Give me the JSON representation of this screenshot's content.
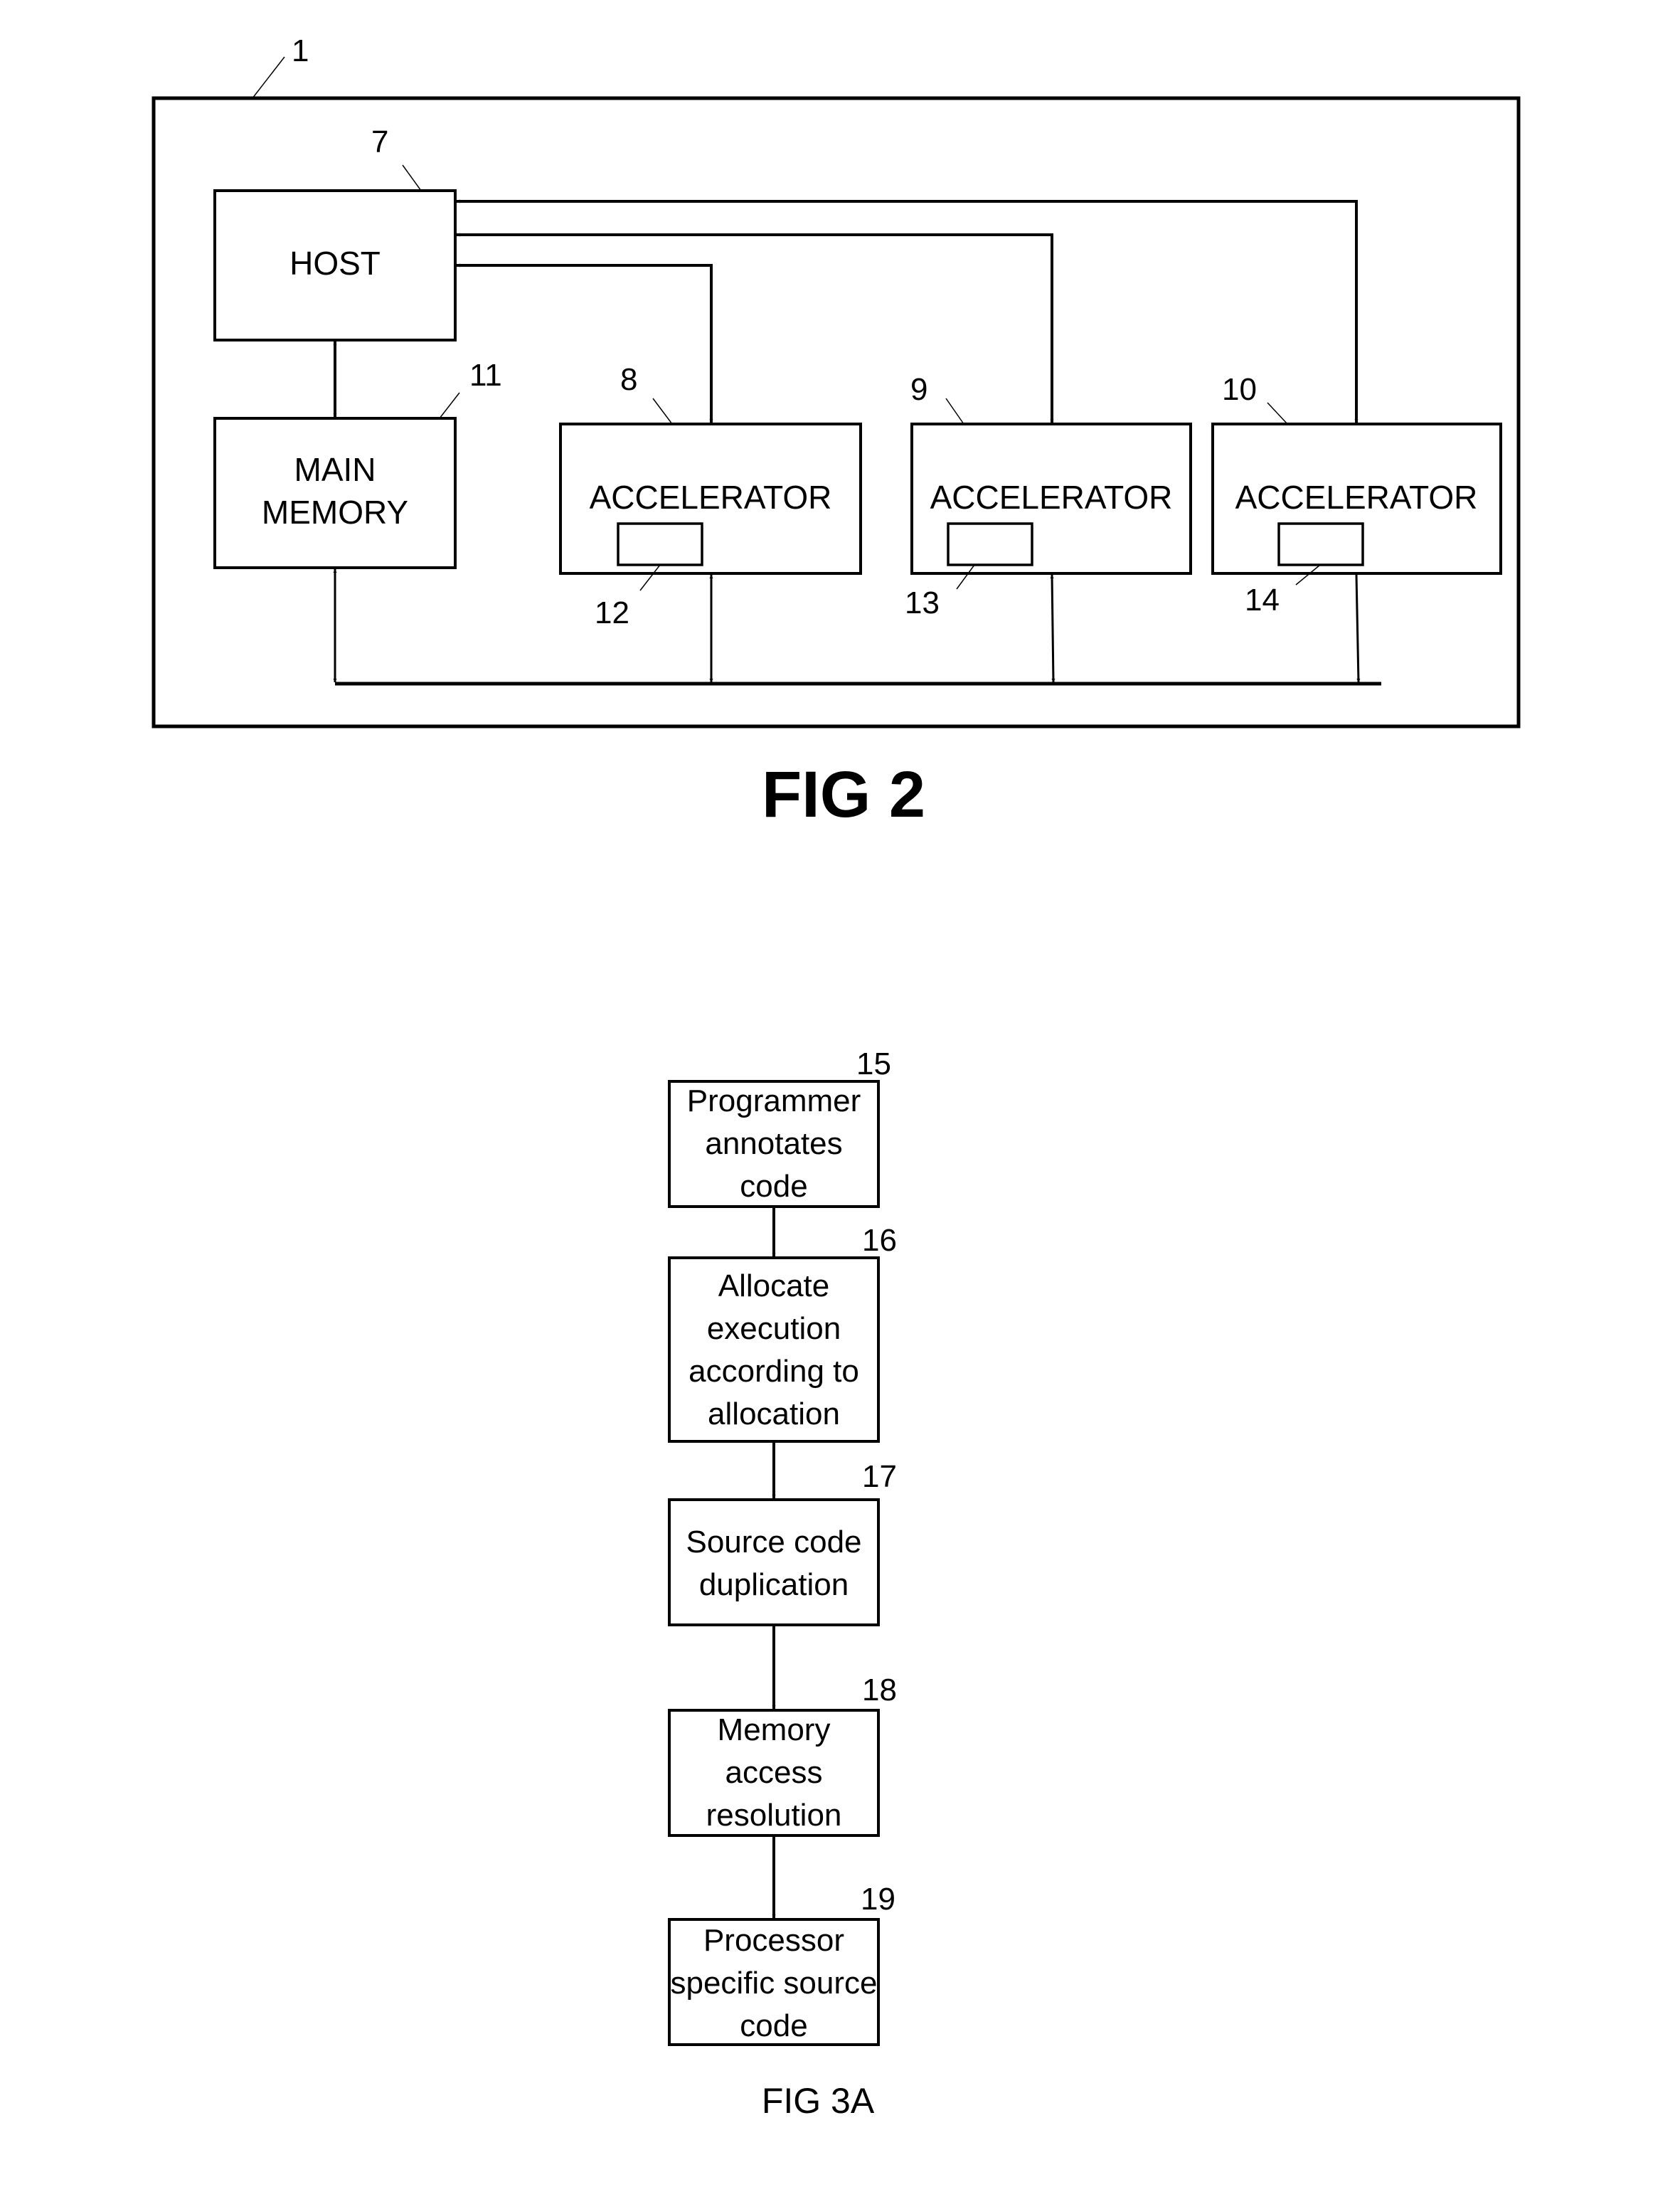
{
  "fig2": {
    "caption": "FIG 2",
    "system_ref": "1",
    "host": {
      "label": "HOST",
      "ref": "7"
    },
    "main_memory": {
      "label_line1": "MAIN",
      "label_line2": "MEMORY",
      "ref": "11"
    },
    "accelerators": [
      {
        "label": "ACCELERATOR",
        "ref": "8",
        "inner_ref": "12"
      },
      {
        "label": "ACCELERATOR",
        "ref": "9",
        "inner_ref": "13"
      },
      {
        "label": "ACCELERATOR",
        "ref": "10",
        "inner_ref": "14"
      }
    ]
  },
  "fig3a": {
    "caption": "FIG 3A",
    "steps": [
      {
        "ref": "15",
        "lines": [
          "Programmer",
          "annotates",
          "code"
        ]
      },
      {
        "ref": "16",
        "lines": [
          "Allocate",
          "execution",
          "according to",
          "allocation"
        ]
      },
      {
        "ref": "17",
        "lines": [
          "Source code",
          "duplication"
        ]
      },
      {
        "ref": "18",
        "lines": [
          "Memory",
          "access",
          "resolution"
        ]
      },
      {
        "ref": "19",
        "lines": [
          "Processor",
          "specific source",
          "code"
        ]
      }
    ]
  }
}
